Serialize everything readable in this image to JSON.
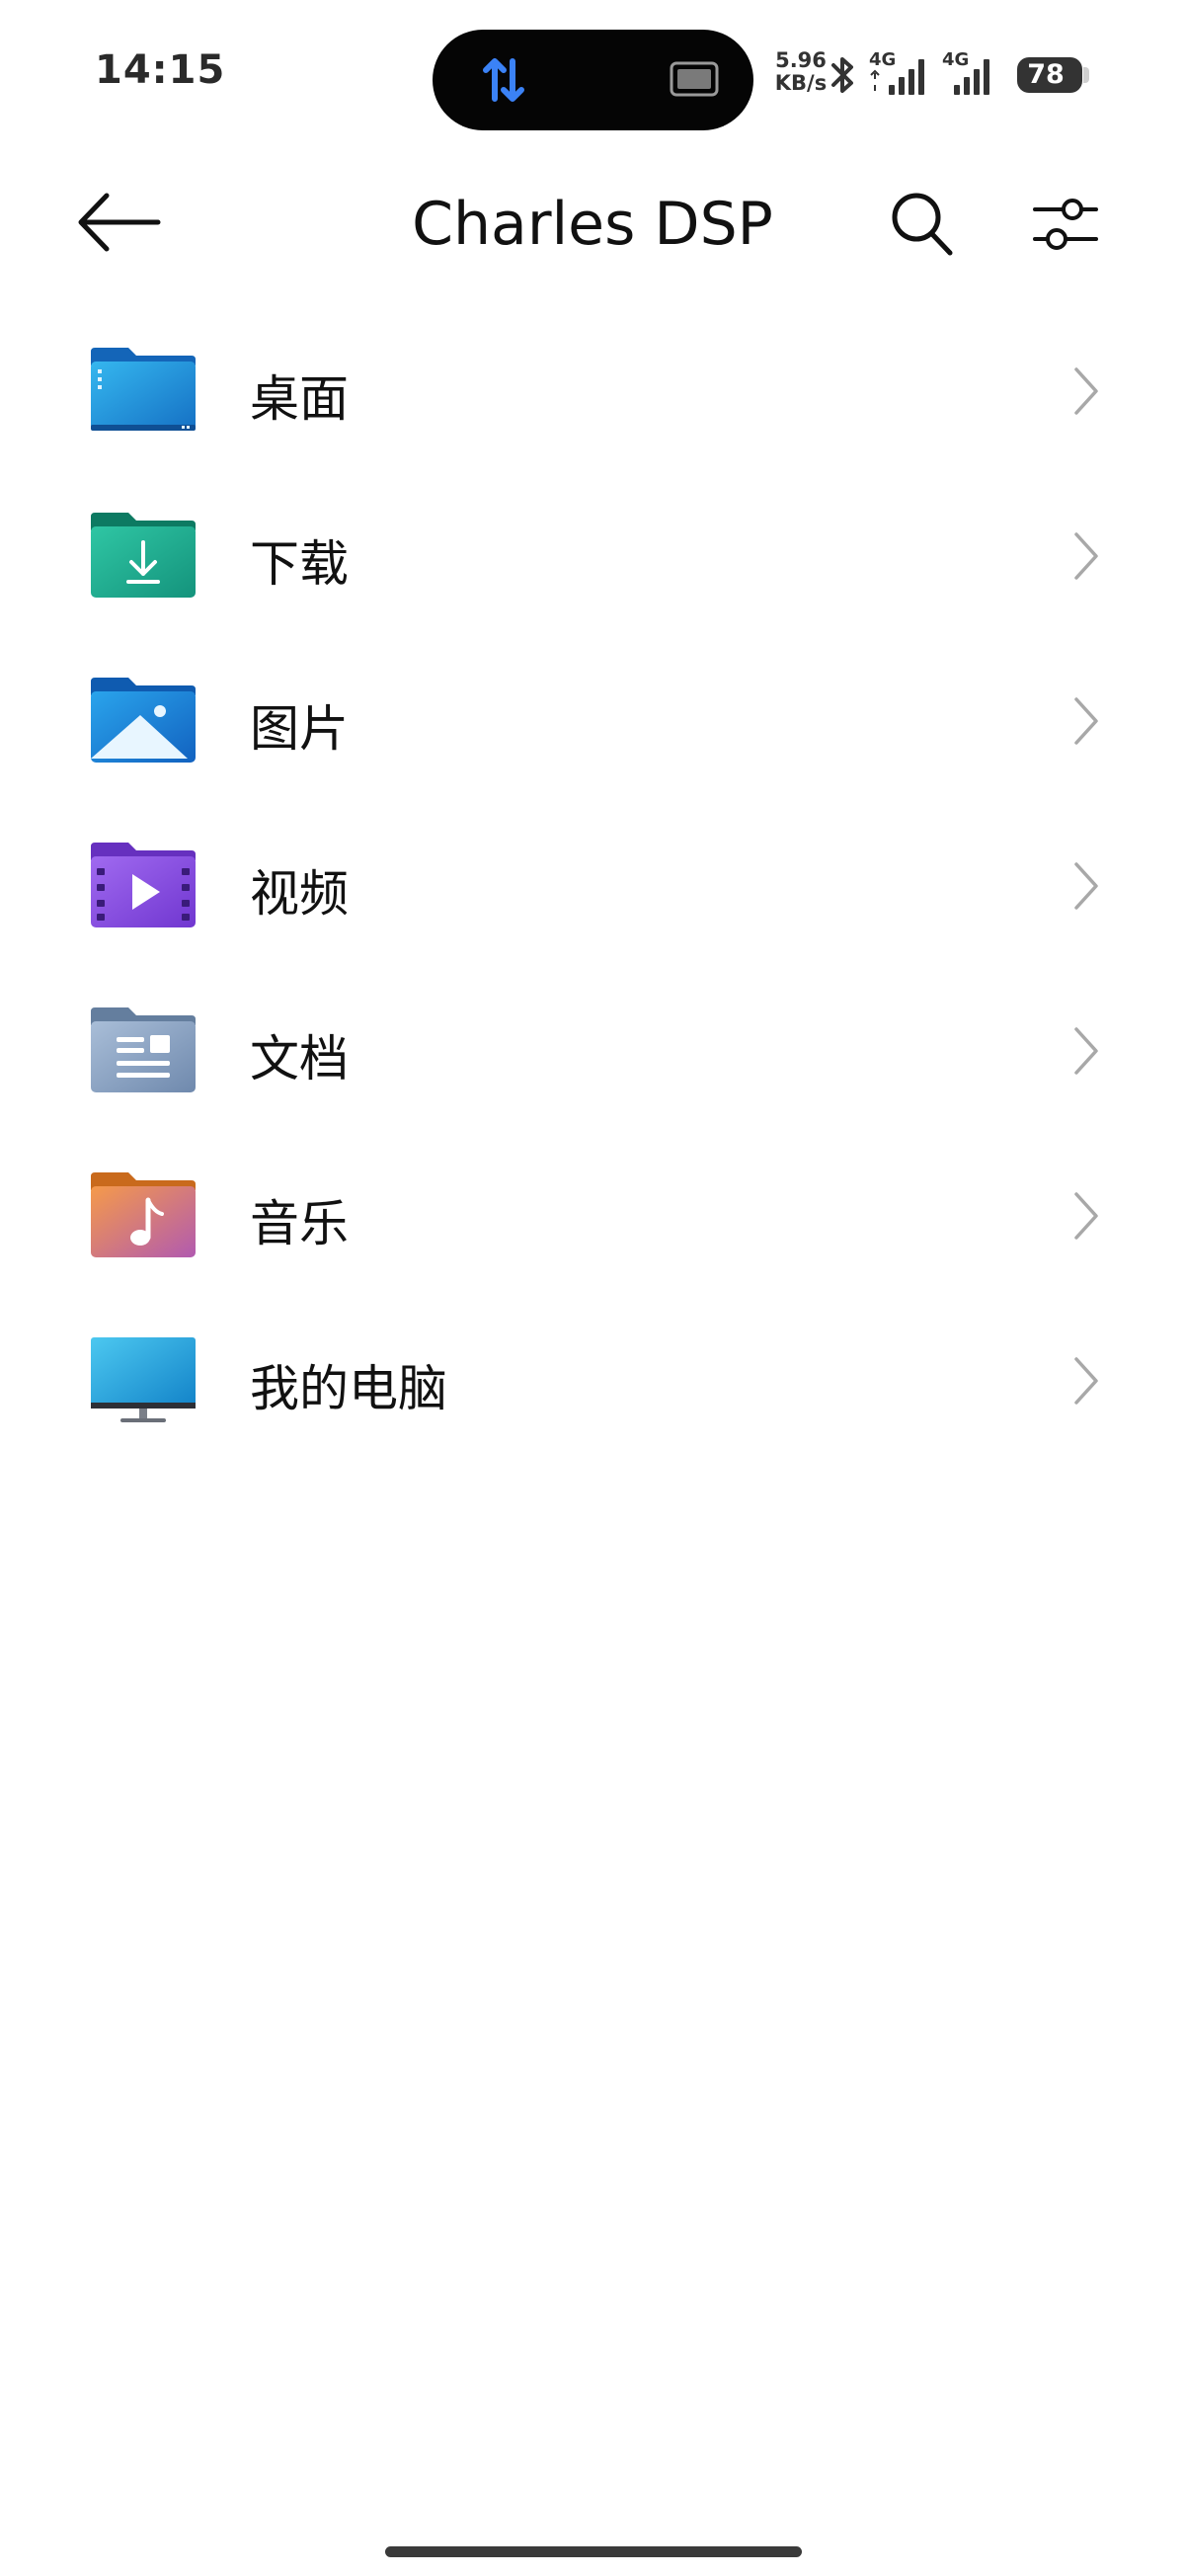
{
  "status_bar": {
    "time": "14:15",
    "net_speed_value": "5.96",
    "net_speed_unit": "KB/s",
    "signal_1_label": "4G",
    "signal_2_label": "4G",
    "battery_level": "78",
    "colors": {
      "island_accent": "#3b82f6",
      "text": "#333333"
    }
  },
  "header": {
    "title": "Charles DSP",
    "back_icon": "arrow-left-icon",
    "search_icon": "search-icon",
    "filter_icon": "sliders-icon"
  },
  "folders": [
    {
      "label": "桌面",
      "icon": "desktop-folder-icon",
      "color": "#1e90d8"
    },
    {
      "label": "下载",
      "icon": "download-folder-icon",
      "color": "#17a88b"
    },
    {
      "label": "图片",
      "icon": "pictures-folder-icon",
      "color": "#1a7fd6"
    },
    {
      "label": "视频",
      "icon": "videos-folder-icon",
      "color": "#8a4ee0"
    },
    {
      "label": "文档",
      "icon": "documents-folder-icon",
      "color": "#7a93b5"
    },
    {
      "label": "音乐",
      "icon": "music-folder-icon",
      "color": "#e8795c"
    },
    {
      "label": "我的电脑",
      "icon": "monitor-icon",
      "color": "#24a3d8"
    }
  ]
}
